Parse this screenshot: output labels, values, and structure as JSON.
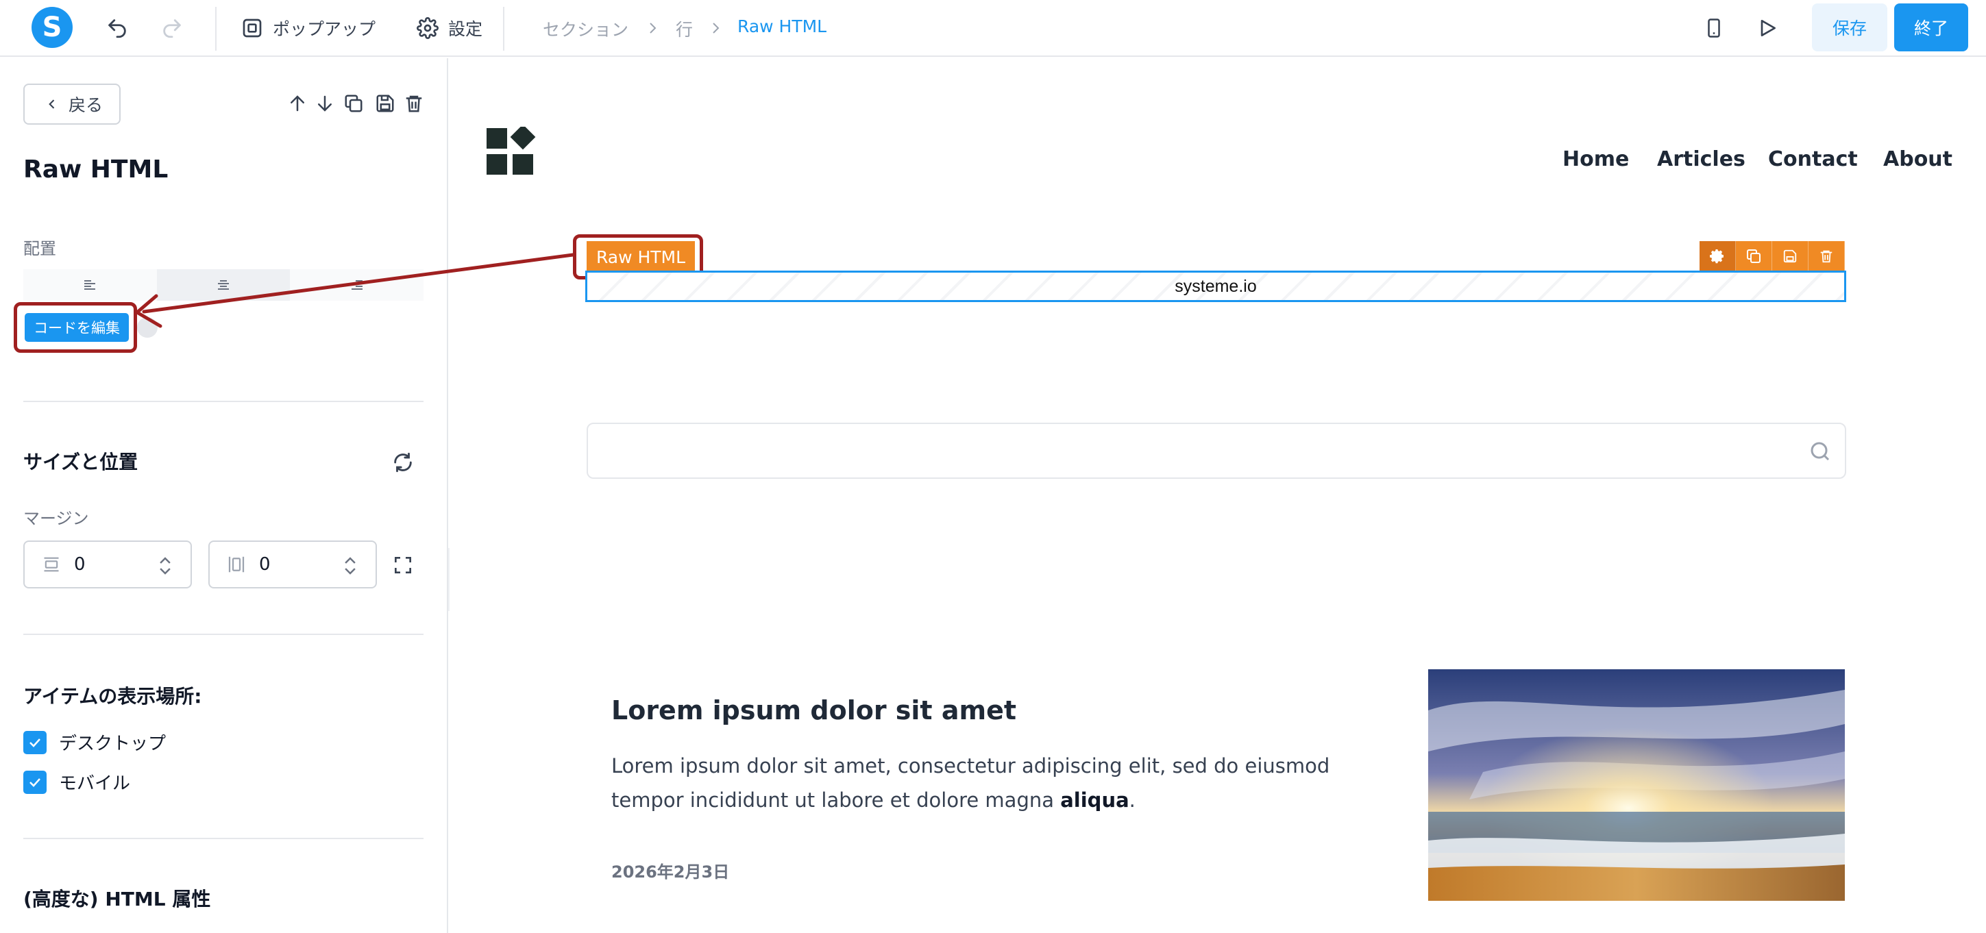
{
  "app": {
    "logo_letter": "S"
  },
  "toolbar": {
    "popup_label": "ポップアップ",
    "settings_label": "設定",
    "save_label": "保存",
    "done_label": "終了"
  },
  "breadcrumb": [
    {
      "label": "セクション"
    },
    {
      "label": "行"
    },
    {
      "label": "Raw HTML"
    }
  ],
  "sidebar": {
    "back_label": "戻る",
    "title": "Raw HTML",
    "alignment_label": "配置",
    "edit_code_label": "コードを編集",
    "size_heading": "サイズと位置",
    "margin_label": "マージン",
    "margin_horizontal": "0",
    "margin_vertical": "0",
    "visibility_heading": "アイテムの表示場所:",
    "desktop_label": "デスクトップ",
    "mobile_label": "モバイル",
    "desktop_checked": true,
    "mobile_checked": true,
    "advanced_heading": "(高度な) HTML 属性"
  },
  "canvas": {
    "nav": [
      "Home",
      "Articles",
      "Contact",
      "About"
    ],
    "element_tag": "Raw HTML",
    "raw_html_content": "systeme.io",
    "post": {
      "title": "Lorem ipsum dolor sit amet",
      "text": "Lorem ipsum dolor sit amet, consectetur adipiscing elit, sed do eiusmod tempor incididunt ut labore et dolore magna ",
      "text_bold": "aliqua",
      "text_end": ".",
      "date": "2026年2月3日"
    }
  },
  "colors": {
    "accent": "#1a96f0",
    "element_orange": "#f08a24",
    "annotation": "#a02020"
  }
}
